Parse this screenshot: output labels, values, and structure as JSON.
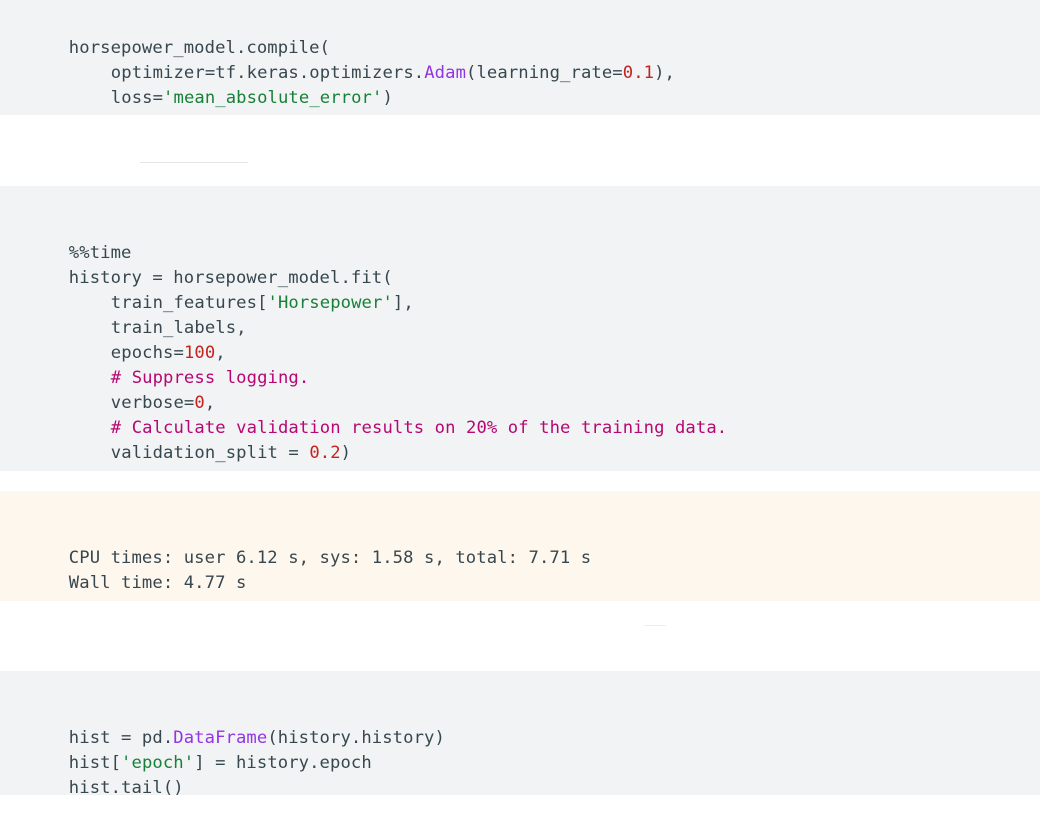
{
  "cell1": {
    "l1": "horsepower_model.compile(",
    "l2_a": "optimizer=tf.keras.optimizers.",
    "l2_fn": "Adam",
    "l2_b": "(learning_rate=",
    "l2_num": "0.1",
    "l2_c": "),",
    "l3_a": "loss=",
    "l3_str": "'mean_absolute_error'",
    "l3_b": ")"
  },
  "cell2": {
    "l1": "%%time",
    "l2": "history = horsepower_model.fit(",
    "l3_a": "train_features[",
    "l3_str": "'Horsepower'",
    "l3_b": "],",
    "l4": "train_labels,",
    "l5_a": "epochs=",
    "l5_num": "100",
    "l5_b": ",",
    "l6": "# Suppress logging.",
    "l7_a": "verbose=",
    "l7_num": "0",
    "l7_b": ",",
    "l8": "# Calculate validation results on 20% of the training data.",
    "l9_a": "validation_split = ",
    "l9_num": "0.2",
    "l9_b": ")"
  },
  "output1": {
    "l1": "CPU times: user 6.12 s, sys: 1.58 s, total: 7.71 s",
    "l2": "Wall time: 4.77 s"
  },
  "cell3": {
    "l1_a": "hist = pd.",
    "l1_fn": "DataFrame",
    "l1_b": "(history.history)",
    "l2_a": "hist[",
    "l2_str": "'epoch'",
    "l2_b": "] = history.epoch",
    "l3": "hist.tail()"
  }
}
